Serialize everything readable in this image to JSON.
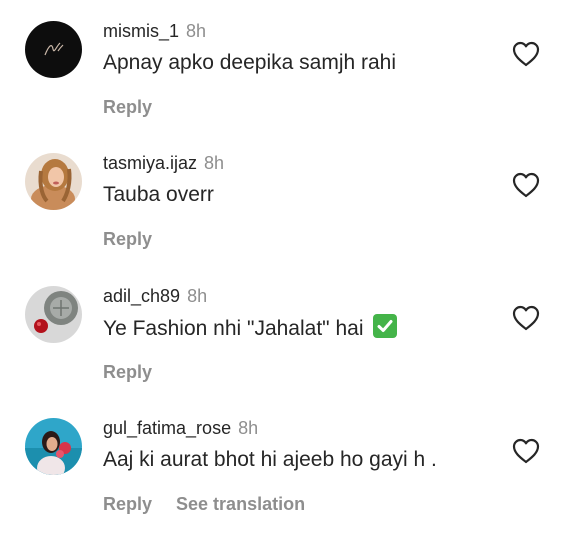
{
  "comments": [
    {
      "username": "mismis_1",
      "time": "8h",
      "text": "Apnay apko deepika samjh rahi",
      "reply_label": "Reply",
      "avatar": "dark-logo-avatar"
    },
    {
      "username": "tasmiya.ijaz",
      "time": "8h",
      "text": "Tauba overr",
      "reply_label": "Reply",
      "avatar": "photo-avatar"
    },
    {
      "username": "adil_ch89",
      "time": "8h",
      "text": "Ye Fashion nhi \"Jahalat\" hai",
      "emoji": "check-mark-button-icon",
      "reply_label": "Reply",
      "avatar": "photo-avatar"
    },
    {
      "username": "gul_fatima_rose",
      "time": "8h",
      "text": "Aaj ki aurat bhot hi ajeeb ho gayi h .",
      "reply_label": "Reply",
      "translate_label": "See translation",
      "avatar": "photo-avatar"
    }
  ],
  "colors": {
    "text": "#262626",
    "secondary": "#8e8e8e",
    "check_emoji": "#44b449"
  }
}
